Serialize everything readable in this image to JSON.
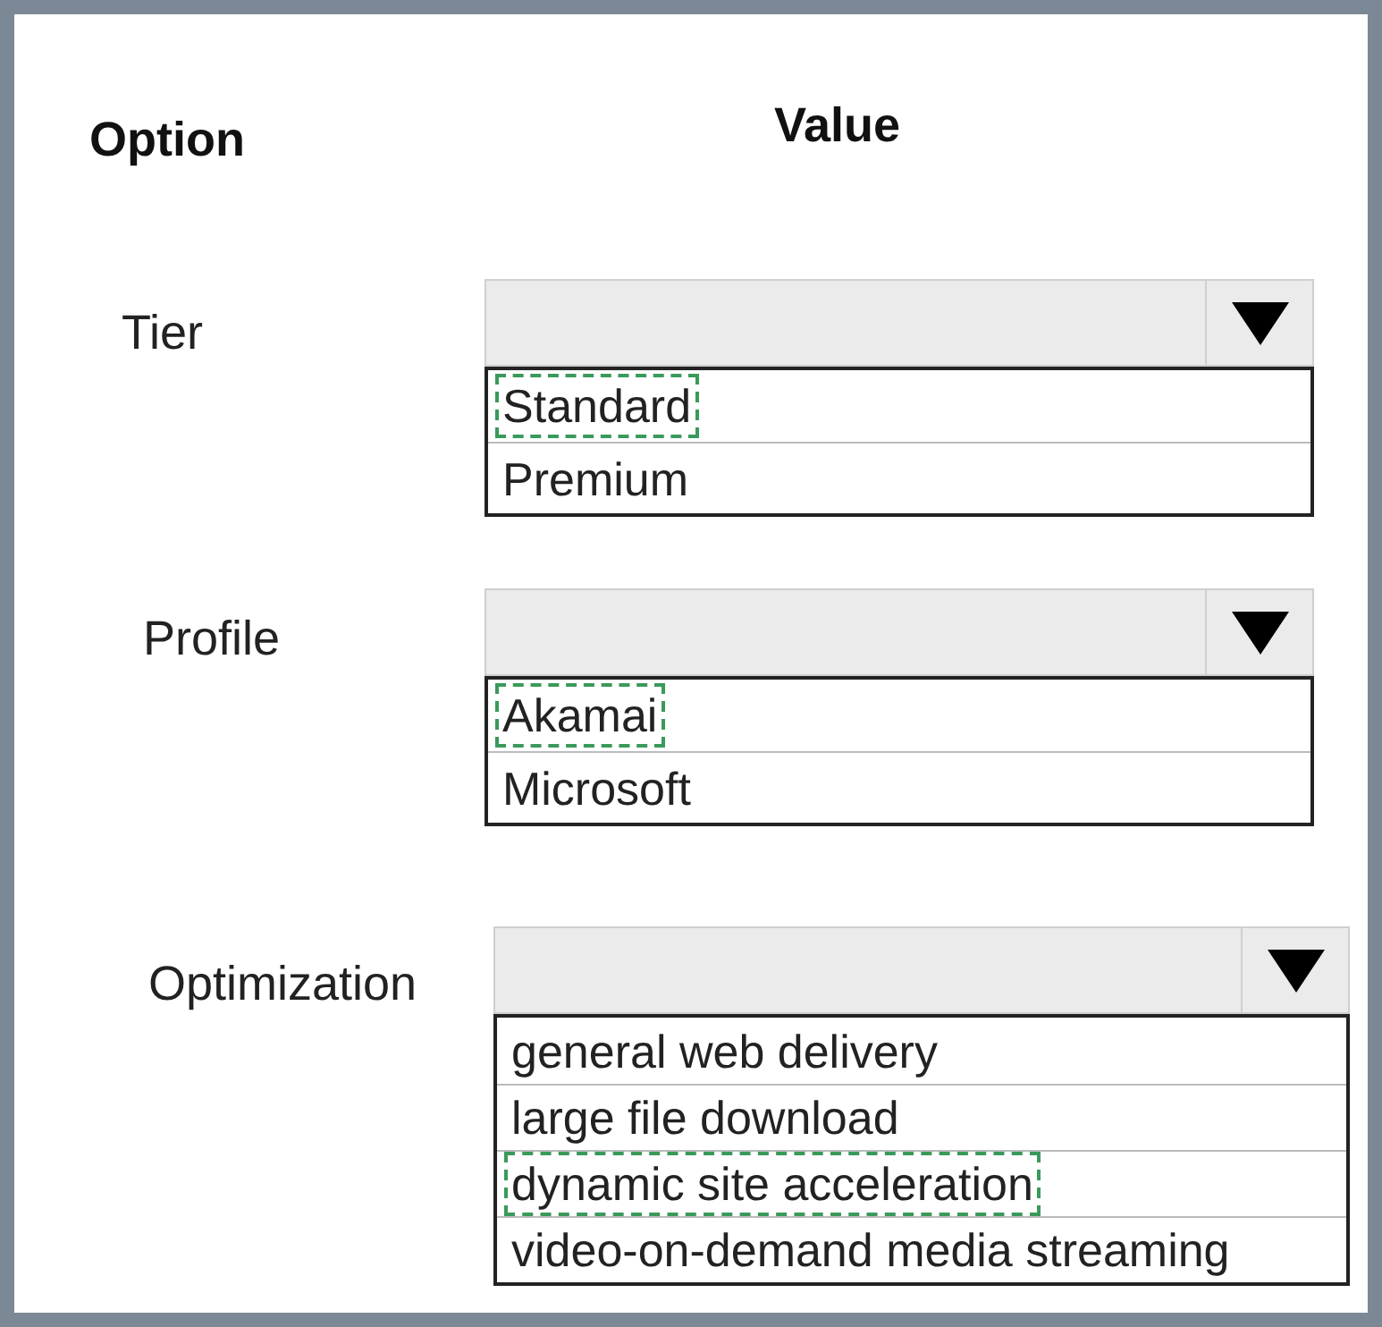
{
  "headers": {
    "option": "Option",
    "value": "Value"
  },
  "rows": [
    {
      "label": "Tier",
      "options": [
        {
          "label": "Standard",
          "selected": true
        },
        {
          "label": "Premium",
          "selected": false
        }
      ]
    },
    {
      "label": "Profile",
      "options": [
        {
          "label": "Akamai",
          "selected": true
        },
        {
          "label": "Microsoft",
          "selected": false
        }
      ]
    },
    {
      "label": "Optimization",
      "options": [
        {
          "label": "general web delivery",
          "selected": false
        },
        {
          "label": "large file download",
          "selected": false
        },
        {
          "label": "dynamic site acceleration",
          "selected": true
        },
        {
          "label": "video-on-demand media streaming",
          "selected": false
        }
      ]
    }
  ]
}
